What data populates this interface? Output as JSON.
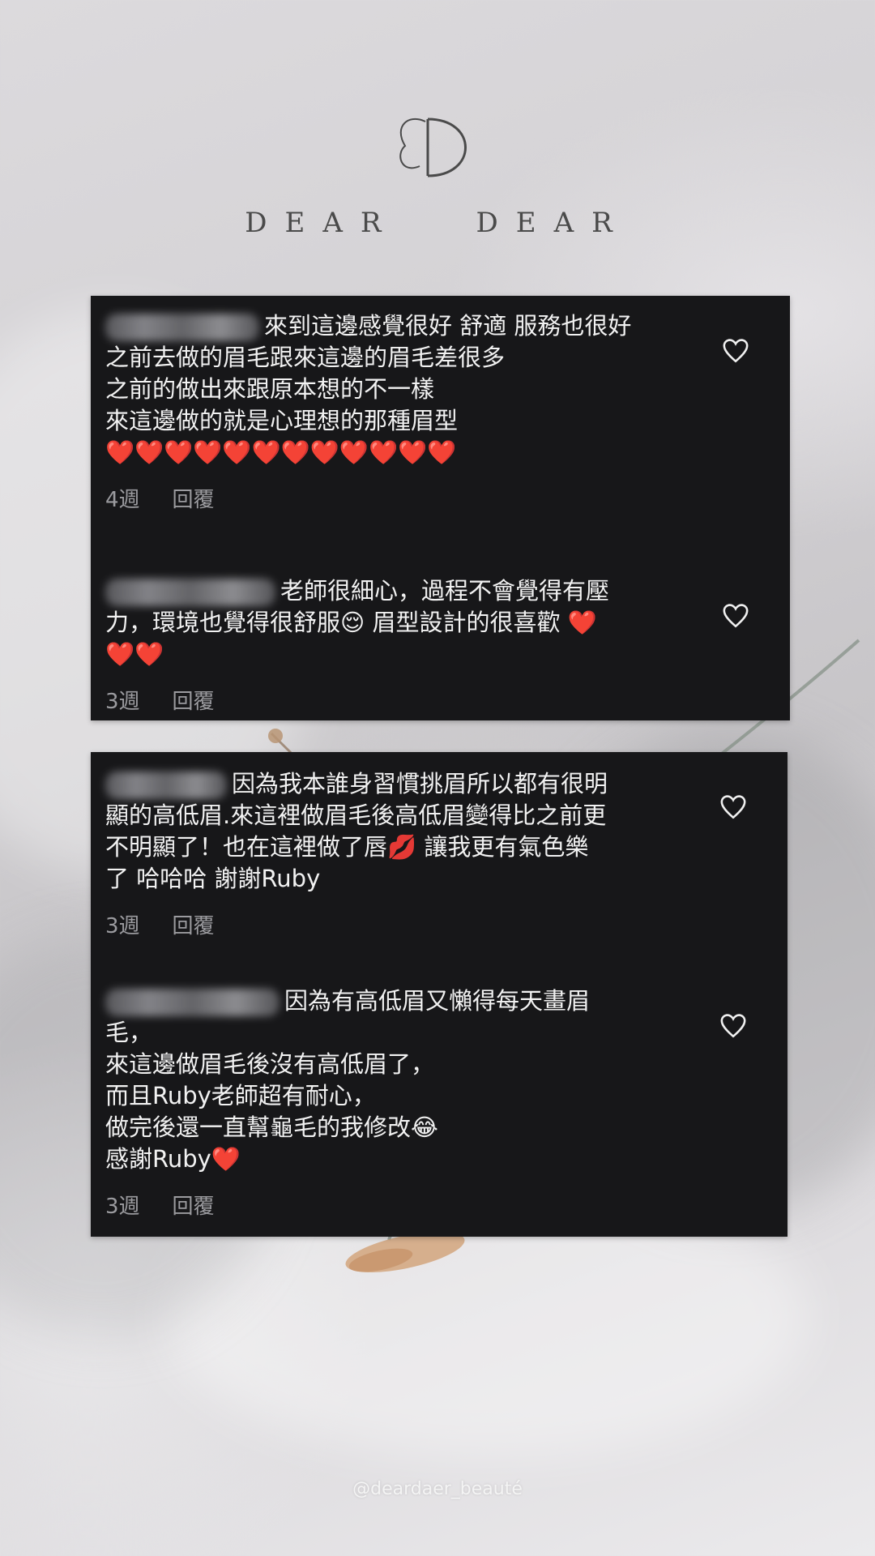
{
  "header": {
    "logo_letter": "D",
    "brand_left": "DEAR",
    "brand_right": "DEAR"
  },
  "cards": [
    {
      "comments": [
        {
          "text": "來到這邊感覺很好 舒適 服務也很好\n之前去做的眉毛跟來這邊的眉毛差很多\n之前的做出來跟原本想的不一樣\n來這邊做的就是心理想的那種眉型\n❤️❤️❤️❤️❤️❤️❤️❤️❤️❤️❤️❤️",
          "time": "4週",
          "reply": "回覆"
        },
        {
          "text": "老師很細心，過程不會覺得有壓\n力，環境也覺得很舒服😌 眉型設計的很喜歡 ❤️\n❤️❤️",
          "time": "3週",
          "reply": "回覆"
        }
      ]
    },
    {
      "comments": [
        {
          "text": "因為我本誰身習慣挑眉所以都有很明\n顯的高低眉.來這裡做眉毛後高低眉變得比之前更\n不明顯了！也在這裡做了唇💋 讓我更有氣色樂\n了 哈哈哈 謝謝Ruby",
          "time": "3週",
          "reply": "回覆"
        },
        {
          "text": "因為有高低眉又懶得每天畫眉\n毛，\n來這邊做眉毛後沒有高低眉了，\n而且Ruby老師超有耐心，\n做完後還一直幫龜毛的我修改😂\n感謝Ruby❤️",
          "time": "3週",
          "reply": "回覆"
        }
      ]
    }
  ],
  "footer": {
    "handle": "@deardaer_beauté"
  },
  "colors": {
    "card_bg": "#171719",
    "meta_gray": "#9b9b9f",
    "brand_text": "#4a4a4a"
  },
  "icons": [
    "logo-butterfly-d",
    "heart-outline-icon"
  ]
}
